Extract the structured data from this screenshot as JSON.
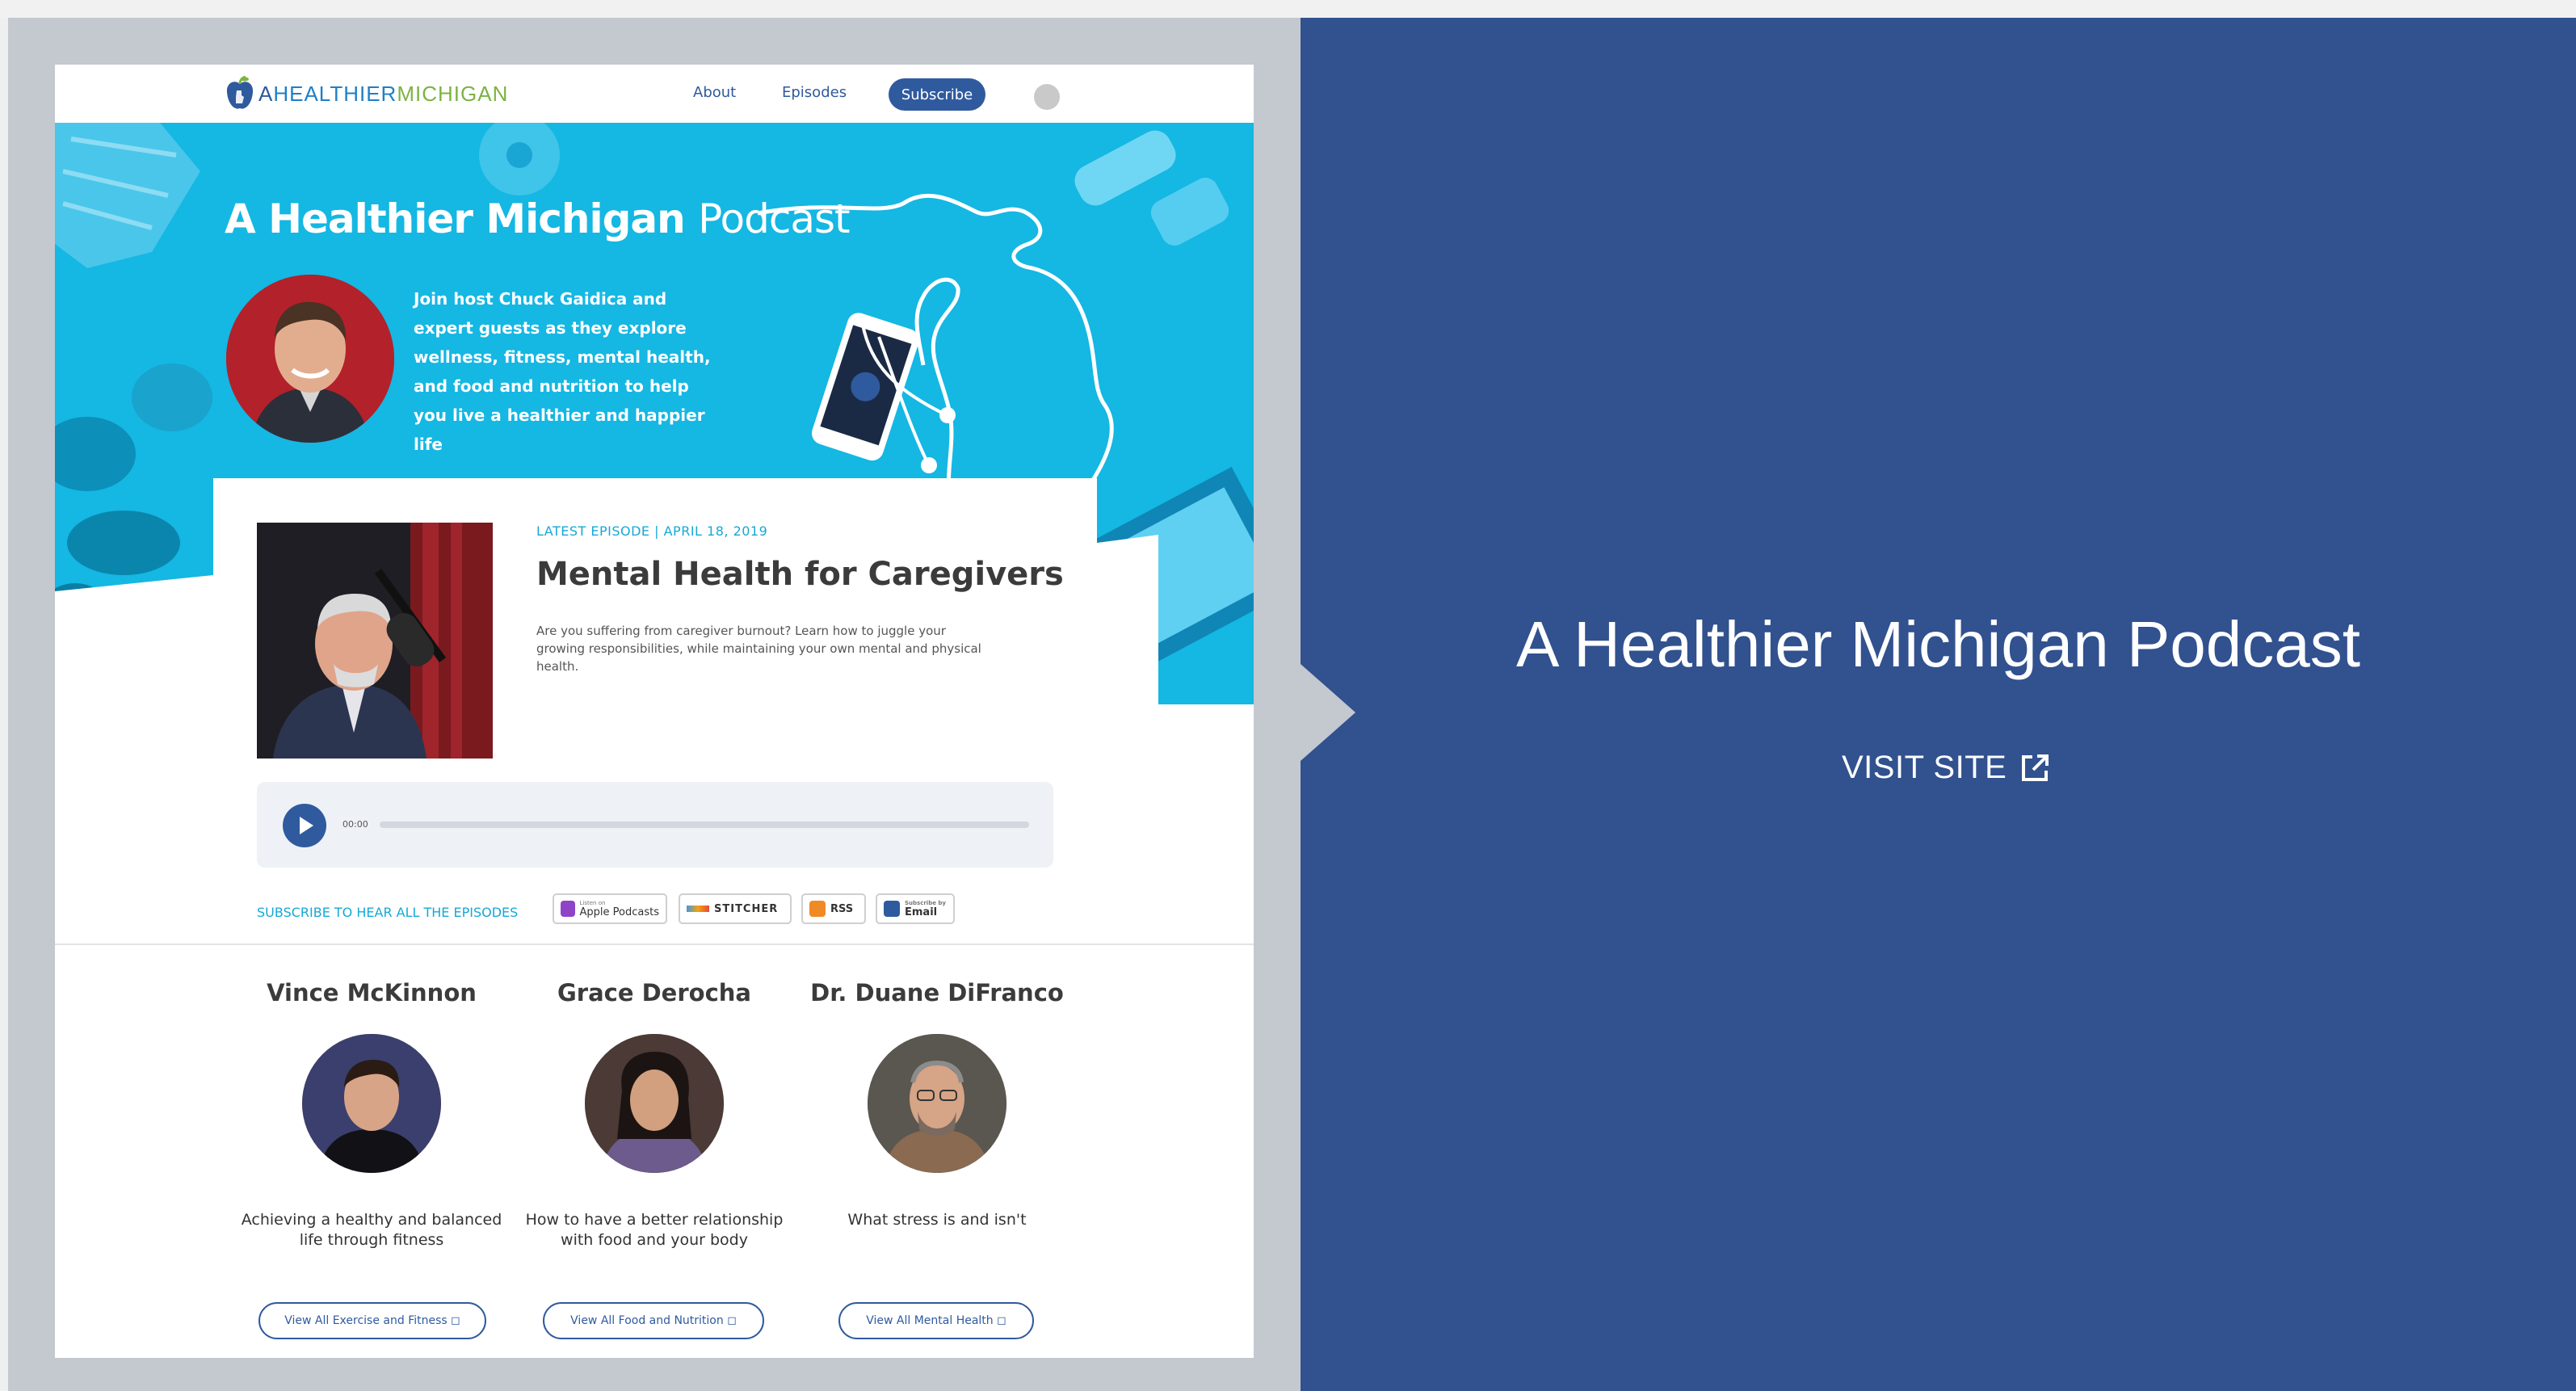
{
  "nav": {
    "logo_a": "A",
    "logo_healthier": "HEALTHIER",
    "logo_michigan": "MICHIGAN",
    "about": "About",
    "episodes": "Episodes",
    "subscribe": "Subscribe"
  },
  "hero": {
    "title_bold": "A Healthier Michigan",
    "title_light": "Podcast",
    "description": "Join host Chuck Gaidica and expert guests as they explore wellness, fitness, mental health, and food and nutrition to help you live a healthier and happier life"
  },
  "episode": {
    "meta": "LATEST EPISODE  |  APRIL 18, 2019",
    "title": "Mental Health for Caregivers",
    "description": "Are you suffering from caregiver burnout? Learn how to juggle your growing responsibilities, while maintaining your own mental and physical health.",
    "time": "00:00"
  },
  "subscribe_row": {
    "label": "SUBSCRIBE TO HEAR ALL THE EPISODES",
    "apple_small": "Listen on",
    "apple": "Apple Podcasts",
    "stitcher": "STITCHER",
    "rss": "RSS",
    "email_small": "Subscribe by",
    "email": "Email"
  },
  "experts": [
    {
      "name": "Vince McKinnon",
      "desc": "Achieving a healthy and balanced life through fitness",
      "button": "View All Exercise and Fitness"
    },
    {
      "name": "Grace Derocha",
      "desc": "How to have a better relationship with food and your body",
      "button": "View All Food and Nutrition"
    },
    {
      "name": "Dr. Duane DiFranco",
      "desc": "What stress is and isn't",
      "button": "View All Mental Health"
    }
  ],
  "right_panel": {
    "title": "A Healthier Michigan Podcast",
    "visit": "VISIT SITE"
  },
  "colors": {
    "navy": "#31518f",
    "hero_cyan": "#15b7e3",
    "link_blue": "#2f5a9e",
    "accent_cyan": "#15a8d6"
  },
  "icons": [
    "apple-logo-icon",
    "play-icon",
    "external-link-icon",
    "podcast-icon",
    "stitcher-icon",
    "rss-icon",
    "email-icon"
  ]
}
